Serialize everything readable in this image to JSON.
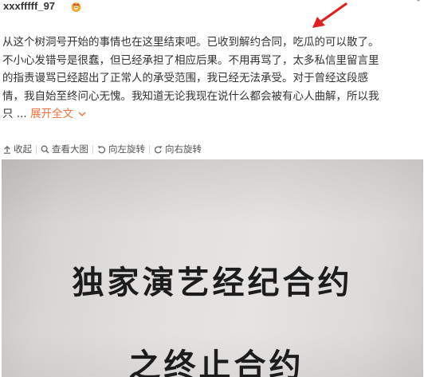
{
  "post": {
    "username": "xxxfffff_97",
    "body_lines": [
      "从这个树洞号开始的事情也在这里结束吧。已收到解约合同，吃瓜的可以散了。",
      "不小心发错号是很蠢，但已经承担了相应后果。不用再骂了，太多私信里留言里",
      "的指责谩骂已经超出了正常人的承受范围，我已经无法承受。对于曾经这段感",
      "情，我自始至终问心无愧。我知道无论我现在说什么都会被有心人曲解，所以我"
    ],
    "last_line_prefix": "只 ...",
    "expand_label": "展开全文"
  },
  "toolbar": {
    "collapse_label": "收起",
    "view_large_label": "查看大图",
    "rotate_left_label": "向左旋转",
    "rotate_right_label": "向右旋转"
  },
  "photo": {
    "line1": "独家演艺经纪合约",
    "line2": "之终止合约"
  },
  "colors": {
    "accent_orange": "#eb7340",
    "annotation_red": "#e02020",
    "text": "#333333"
  },
  "icons": {
    "badge": "vip-crown-icon",
    "chevron": "chevron-down-icon",
    "arrow": "red-arrow-annotation"
  }
}
